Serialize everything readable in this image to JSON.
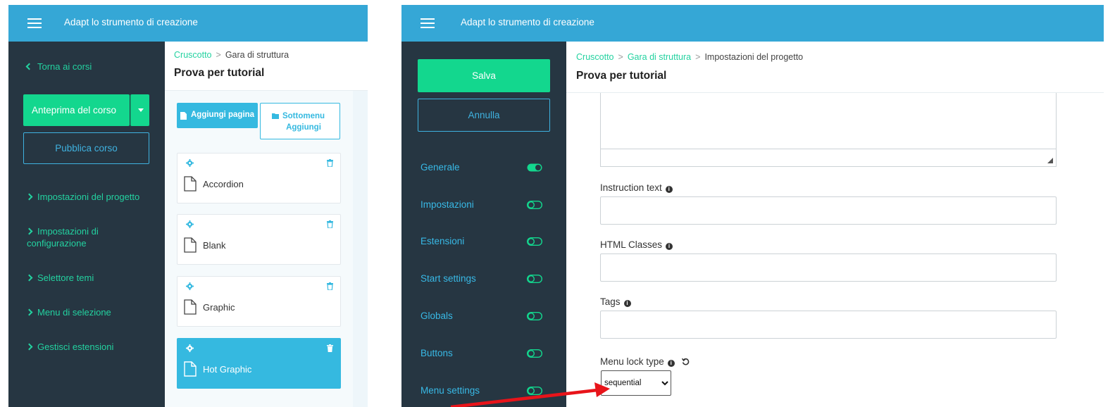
{
  "app_title": "Adapt lo strumento di creazione",
  "left": {
    "back_link": "Torna ai corsi",
    "preview_button": "Anteprima del corso",
    "publish_button": "Pubblica corso",
    "menu": [
      "Impostazioni del progetto",
      "Impostazioni di configurazione",
      "Selettore temi",
      "Menu di selezione",
      "Gestisci estensioni"
    ],
    "breadcrumb": [
      "Cruscotto",
      "Gara di struttura"
    ],
    "page_title": "Prova per tutorial",
    "add_page_button": "Aggiungi pagina",
    "add_submenu_button": "Sottomenu Aggiungi",
    "pages": [
      "Accordion",
      "Blank",
      "Graphic",
      "Hot Graphic"
    ],
    "selected_page": "Hot Graphic"
  },
  "right": {
    "save_button": "Salva",
    "cancel_button": "Annulla",
    "sections": [
      {
        "label": "Generale",
        "active": true
      },
      {
        "label": "Impostazioni",
        "active": false
      },
      {
        "label": "Estensioni",
        "active": false
      },
      {
        "label": "Start settings",
        "active": false
      },
      {
        "label": "Globals",
        "active": false
      },
      {
        "label": "Buttons",
        "active": false
      },
      {
        "label": "Menu settings",
        "active": false
      }
    ],
    "breadcrumb": [
      "Cruscotto",
      "Gara di struttura",
      "Impostazioni del progetto"
    ],
    "page_title": "Prova per tutorial",
    "fields": {
      "instruction_text": {
        "label": "Instruction text",
        "value": ""
      },
      "html_classes": {
        "label": "HTML Classes",
        "value": ""
      },
      "tags": {
        "label": "Tags",
        "value": ""
      },
      "menu_lock_type": {
        "label": "Menu lock type",
        "value": "sequential"
      }
    }
  },
  "colors": {
    "topbar": "#35a7d6",
    "sidebar": "#263642",
    "green": "#13d78e",
    "blue_accent": "#35b9e0",
    "arrow": "#e8141a"
  }
}
